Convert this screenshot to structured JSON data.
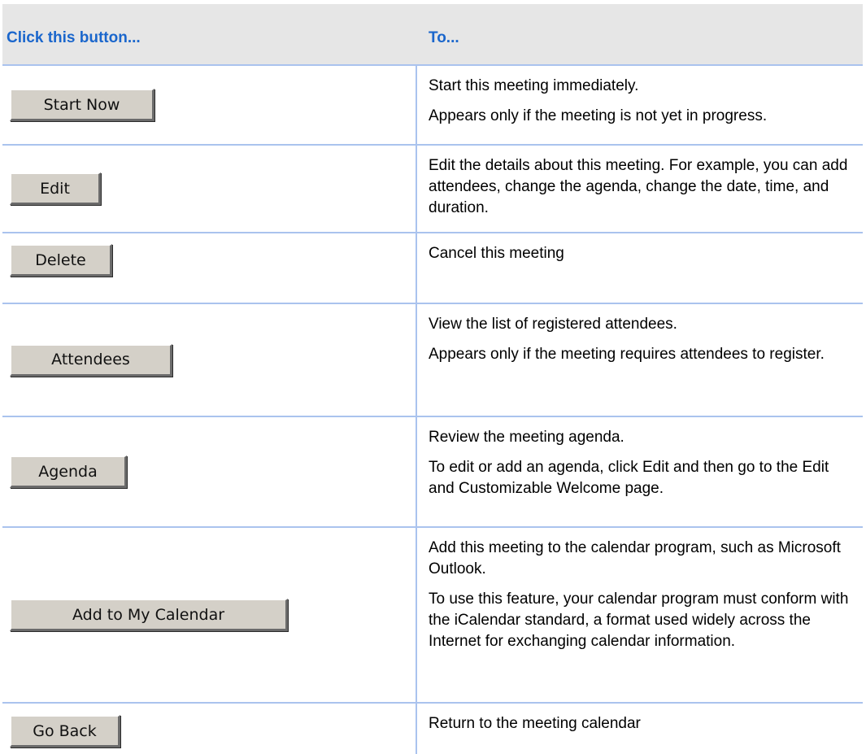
{
  "header": {
    "col1": "Click this button...",
    "col2": "To..."
  },
  "rows": [
    {
      "button": "Start Now",
      "descriptions": [
        "Start this meeting immediately.",
        "Appears only if the meeting is not yet in progress."
      ]
    },
    {
      "button": "Edit",
      "descriptions": [
        "Edit the details about this meeting. For example, you can add attendees, change the agenda, change the date, time, and duration."
      ]
    },
    {
      "button": "Delete",
      "descriptions": [
        "Cancel this meeting"
      ]
    },
    {
      "button": "Attendees",
      "descriptions": [
        "View the list of registered attendees.",
        "Appears only if the meeting requires attendees to register."
      ]
    },
    {
      "button": "Agenda",
      "descriptions": [
        "Review the meeting agenda.",
        "To edit or add an agenda, click Edit and then go to the Edit and Customizable Welcome page."
      ]
    },
    {
      "button": "Add to My Calendar",
      "descriptions": [
        "Add this meeting to the calendar program, such as Microsoft Outlook.",
        "To use this feature, your calendar program must conform with the iCalendar standard, a format used widely across the Internet for exchanging calendar information."
      ]
    },
    {
      "button": "Go Back",
      "descriptions": [
        "Return to the meeting calendar"
      ]
    }
  ]
}
